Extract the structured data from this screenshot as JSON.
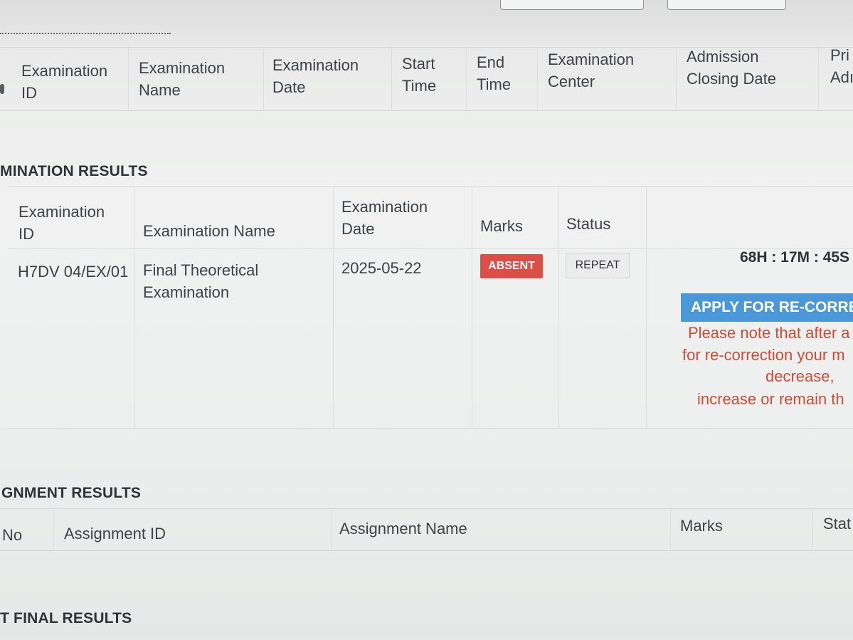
{
  "schedule_table": {
    "headers": [
      [
        "Examination",
        "ID"
      ],
      [
        "Examination",
        "Name"
      ],
      [
        "Examination",
        "Date"
      ],
      [
        "Start",
        "Time"
      ],
      [
        "End",
        "Time"
      ],
      [
        "Examination",
        "Center"
      ],
      [
        "Admission",
        "Closing Date"
      ],
      [
        "Pri",
        "Adı"
      ]
    ]
  },
  "exam_results": {
    "heading": "MINATION RESULTS",
    "headers": {
      "id_1": "Examination",
      "id_2": "ID",
      "name": "Examination Name",
      "date_1": "Examination",
      "date_2": "Date",
      "marks": "Marks",
      "status": "Status"
    },
    "row": {
      "id": "H7DV 04/EX/01",
      "name_1": "Final Theoretical",
      "name_2": "Examination",
      "date": "2025-05-22",
      "marks": "ABSENT",
      "status": "REPEAT",
      "countdown": "68H : 17M : 45S",
      "apply_button": "APPLY FOR RE-CORRECTION",
      "note_lines": [
        "Please note that after a",
        "for re-correction your m",
        "decrease,",
        "increase or remain th"
      ]
    }
  },
  "assignment_results": {
    "heading": "GNMENT RESULTS",
    "headers": {
      "no": "No",
      "id": "Assignment ID",
      "name": "Assignment Name",
      "marks": "Marks",
      "status": "Stat"
    }
  },
  "final_results": {
    "heading": "T FINAL RESULTS"
  },
  "colors": {
    "absent_badge": "#dd4e47",
    "apply_button": "#4b98d8",
    "note_text": "#cf4b33"
  }
}
